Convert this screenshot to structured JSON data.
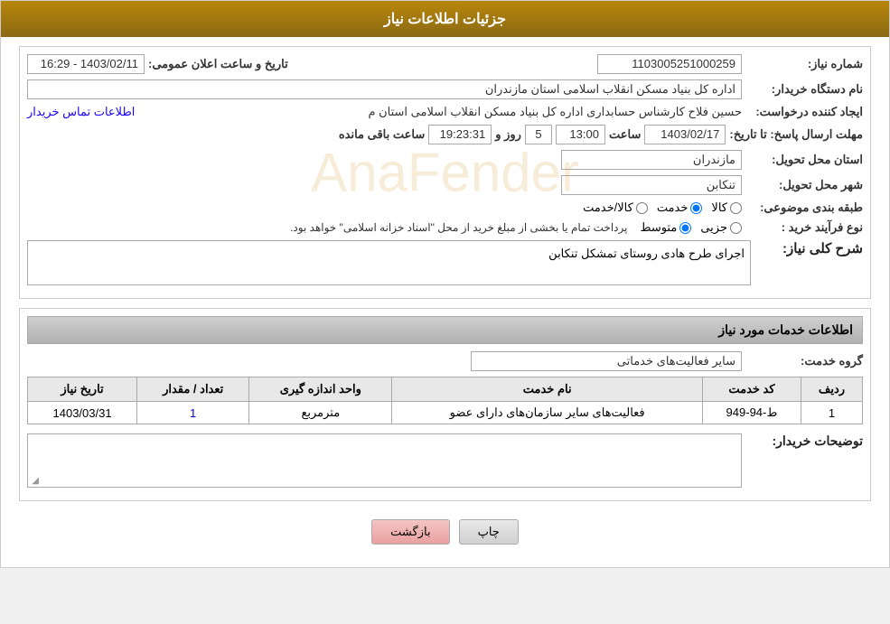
{
  "header": {
    "title": "جزئیات اطلاعات نیاز"
  },
  "fields": {
    "need_number_label": "شماره نیاز:",
    "need_number_value": "1103005251000259",
    "announce_date_label": "تاریخ و ساعت اعلان عمومی:",
    "announce_date_value": "1403/02/11 - 16:29",
    "buyer_org_label": "نام دستگاه خریدار:",
    "buyer_org_value": "اداره کل بنیاد مسکن انقلاب اسلامی استان مازندران",
    "creator_label": "ایجاد کننده درخواست:",
    "creator_value": "حسین فلاح کارشناس حسابداری اداره کل بنیاد مسکن انقلاب اسلامی استان م",
    "creator_link": "اطلاعات تماس خریدار",
    "send_deadline_label": "مهلت ارسال پاسخ: تا تاریخ:",
    "send_date": "1403/02/17",
    "send_time_label": "ساعت",
    "send_time": "13:00",
    "send_days_label": "روز و",
    "send_days": "5",
    "send_remaining_label": "ساعت باقی مانده",
    "send_remaining": "19:23:31",
    "province_label": "استان محل تحویل:",
    "province_value": "مازندران",
    "city_label": "شهر محل تحویل:",
    "city_value": "تنکابن",
    "category_label": "طبقه بندی موضوعی:",
    "category_options": [
      "کالا",
      "خدمت",
      "کالا/خدمت"
    ],
    "category_selected": "خدمت",
    "purchase_type_label": "نوع فرآیند خرید :",
    "purchase_options": [
      "جزیی",
      "متوسط"
    ],
    "purchase_note": "پرداخت تمام یا بخشی از مبلغ خرید از محل \"اسناد خزانه اسلامی\" خواهد بود.",
    "need_description_label": "شرح کلی نیاز:",
    "need_description_value": "اجرای طرح هادی روستای تمشکل تنکابن",
    "services_section_title": "اطلاعات خدمات مورد نیاز",
    "service_group_label": "گروه خدمت:",
    "service_group_value": "سایر فعالیت‌های خدماتی",
    "table": {
      "headers": [
        "ردیف",
        "کد خدمت",
        "نام خدمت",
        "واحد اندازه گیری",
        "تعداد / مقدار",
        "تاریخ نیاز"
      ],
      "rows": [
        {
          "row": "1",
          "code": "ط-94-949",
          "name": "فعالیت‌های سایر سازمان‌های دارای عضو",
          "unit": "مترمربع",
          "qty": "1",
          "date": "1403/03/31"
        }
      ]
    },
    "buyer_desc_label": "توضیحات خریدار:",
    "buyer_desc_value": ""
  },
  "buttons": {
    "print_label": "چاپ",
    "back_label": "بازگشت"
  }
}
